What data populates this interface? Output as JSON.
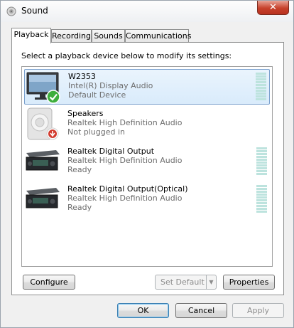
{
  "window": {
    "title": "Sound",
    "close_label": "✕"
  },
  "tabs": [
    {
      "label": "Playback"
    },
    {
      "label": "Recording"
    },
    {
      "label": "Sounds"
    },
    {
      "label": "Communications"
    }
  ],
  "instruction": "Select a playback device below to modify its settings:",
  "devices": [
    {
      "name": "W2353",
      "driver": "Intel(R) Display Audio",
      "status": "Default Device",
      "icon": "monitor-icon",
      "badge": "default-check-badge"
    },
    {
      "name": "Speakers",
      "driver": "Realtek High Definition Audio",
      "status": "Not plugged in",
      "icon": "speaker-icon",
      "badge": "unplugged-badge"
    },
    {
      "name": "Realtek Digital Output",
      "driver": "Realtek High Definition Audio",
      "status": "Ready",
      "icon": "receiver-icon"
    },
    {
      "name": "Realtek Digital Output(Optical)",
      "driver": "Realtek High Definition Audio",
      "status": "Ready",
      "icon": "receiver-icon"
    }
  ],
  "buttons": {
    "configure": "Configure",
    "set_default": "Set Default",
    "properties": "Properties",
    "ok": "OK",
    "cancel": "Cancel",
    "apply": "Apply"
  },
  "colors": {
    "selection": "#d9ebfb",
    "meter": "#bde3de",
    "check": "#3dae3d",
    "unplugged": "#d23b2e"
  }
}
